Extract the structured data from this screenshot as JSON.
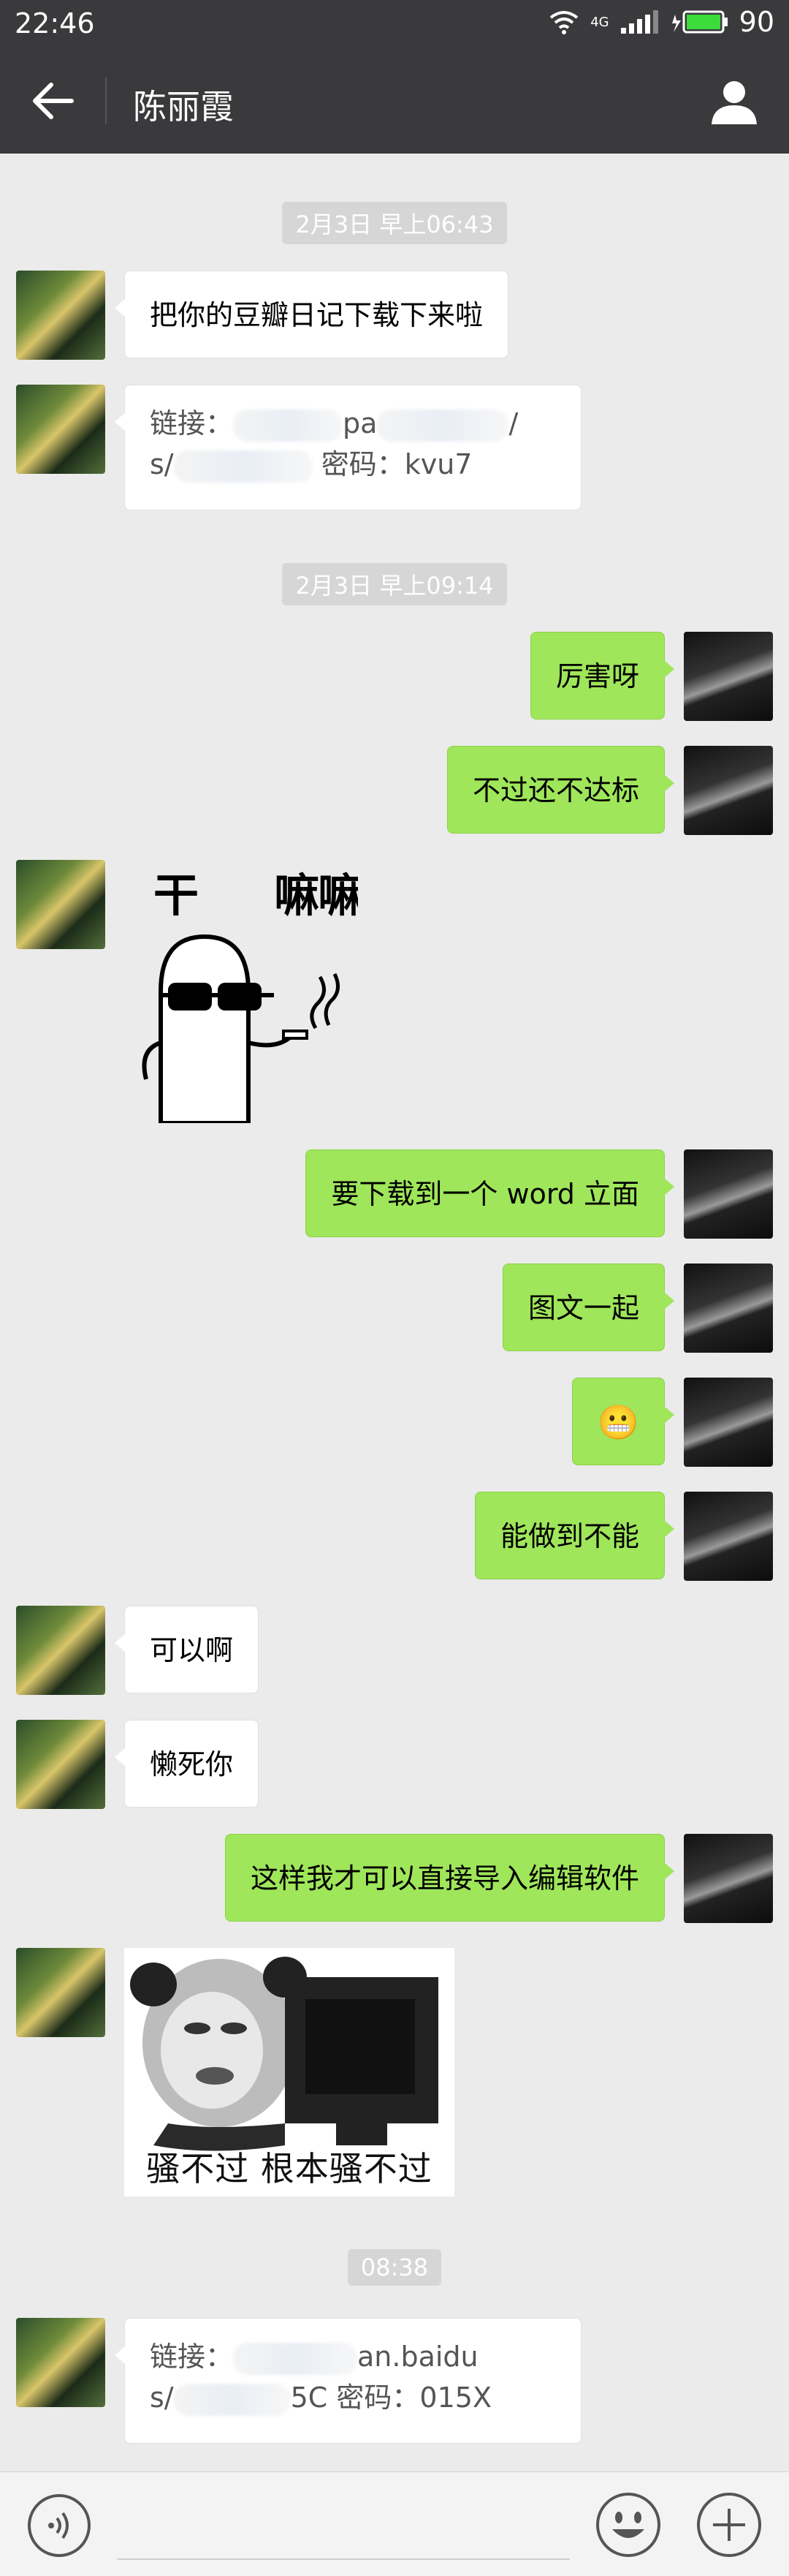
{
  "status_bar": {
    "time": "22:46",
    "battery": "90",
    "network": "4G"
  },
  "header": {
    "title": "陈丽霞"
  },
  "timestamps": [
    "2月3日 早上06:43",
    "2月3日 早上09:14",
    "08:38"
  ],
  "messages": [
    {
      "from": "contact",
      "text": "把你的豆瓣日记下载下来啦"
    },
    {
      "from": "contact",
      "link_line1_prefix": "链接：",
      "link_line1_mid": "pa",
      "link_line1_end": "/",
      "link_line2_prefix": "s/",
      "link_line2_suffix": "密码：kvu7"
    },
    {
      "from": "me",
      "text": "厉害呀"
    },
    {
      "from": "me",
      "text": "不过还不达标"
    },
    {
      "from": "contact",
      "sticker_text_1": "干",
      "sticker_text_2": "嘛"
    },
    {
      "from": "me",
      "text": "要下载到一个 word 立面"
    },
    {
      "from": "me",
      "text": "图文一起"
    },
    {
      "from": "me",
      "emoji": "😬"
    },
    {
      "from": "me",
      "text": "能做到不能"
    },
    {
      "from": "contact",
      "text": "可以啊"
    },
    {
      "from": "contact",
      "text": "懒死你"
    },
    {
      "from": "me",
      "text": "这样我才可以直接导入编辑软件"
    },
    {
      "from": "contact",
      "meme_caption": "骚不过 根本骚不过"
    },
    {
      "from": "contact",
      "link_line1_prefix": "链接：",
      "link_line1_mid": "an.baidu",
      "link_line2_prefix": "s/",
      "link_line2_mid": "5C",
      "link_line2_suffix": "密码：015X"
    }
  ],
  "colors": {
    "header_bg": "#3a3a3c",
    "chat_bg": "#ebebeb",
    "outgoing_bubble": "#9fe65a",
    "incoming_bubble": "#ffffff"
  },
  "icons": [
    "back-arrow-icon",
    "profile-icon",
    "voice-icon",
    "emoji-icon",
    "plus-icon",
    "wifi-icon",
    "signal-icon",
    "battery-icon"
  ]
}
